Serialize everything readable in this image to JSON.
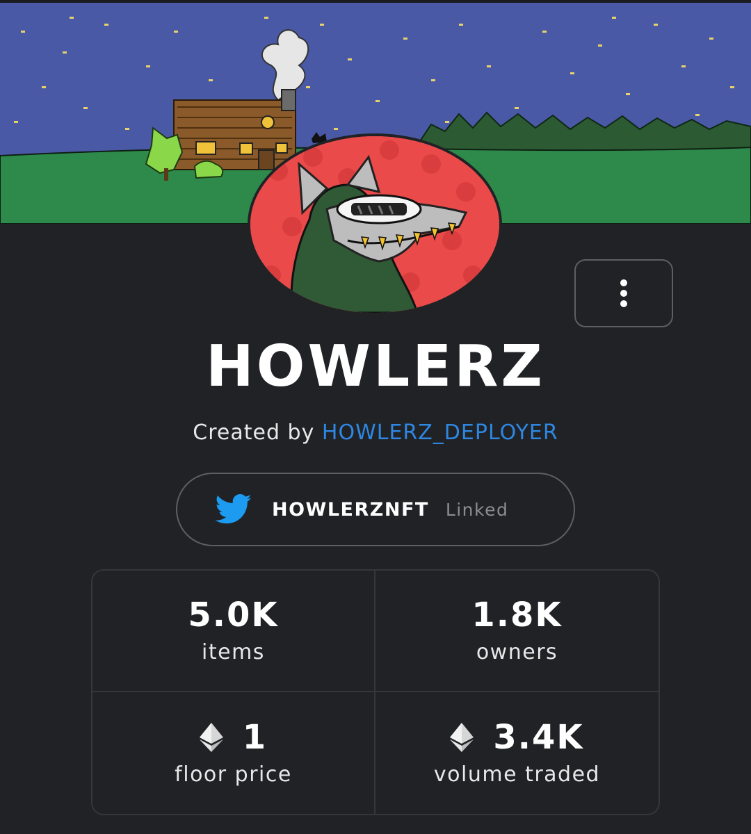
{
  "collection": {
    "name": "HOWLERZ",
    "created_by_label": "Created by",
    "creator_name": "HOWLERZ_DEPLOYER"
  },
  "twitter": {
    "handle": "HOWLERZNFT",
    "status": "Linked",
    "icon": "twitter-bird-icon",
    "color": "#1d9bf0"
  },
  "menu": {
    "icon": "more-vertical-icon"
  },
  "stats": [
    {
      "value": "5.0K",
      "label": "items"
    },
    {
      "value": "1.8K",
      "label": "owners"
    },
    {
      "value": "1",
      "label": "floor price",
      "icon": "ethereum-icon"
    },
    {
      "value": "3.4K",
      "label": "volume traded",
      "icon": "ethereum-icon"
    }
  ],
  "colors": {
    "background": "#202225",
    "link": "#2e87e2",
    "sky": "#4a59a6",
    "grass": "#2d8a4b",
    "avatar_bg": "#ea4a4a"
  }
}
